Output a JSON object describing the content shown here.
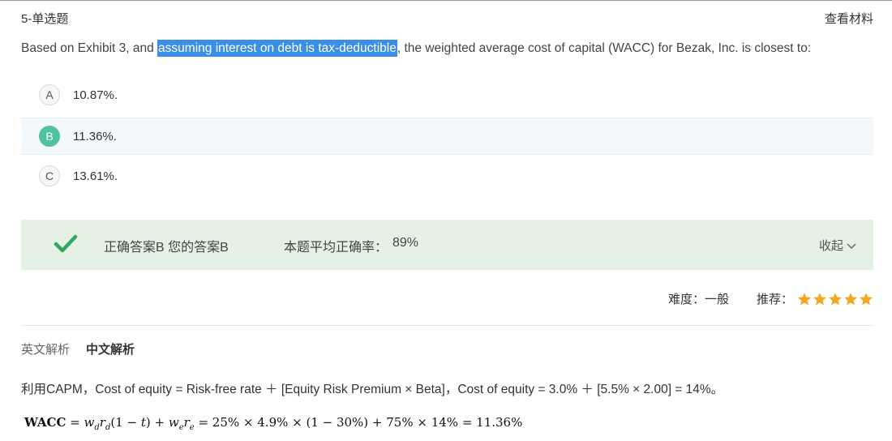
{
  "header": {
    "question_type": "5-单选题",
    "material_link": "查看材料"
  },
  "question": {
    "prefix": "Based on Exhibit 3, and ",
    "highlight": "assuming interest on debt is tax-deductible",
    "suffix": ", the weighted average cost of capital (WACC) for Bezak, Inc. is closest to:"
  },
  "options": [
    {
      "letter": "A",
      "text": "10.87%."
    },
    {
      "letter": "B",
      "text": "11.36%."
    },
    {
      "letter": "C",
      "text": "13.61%."
    }
  ],
  "selected_option": "B",
  "result": {
    "answer_text": "正确答案B 您的答案B",
    "accuracy_label": "本题平均正确率：",
    "accuracy_value": "89%",
    "collapse_label": "收起",
    "status_color": "#2fa75f"
  },
  "meta": {
    "difficulty_label": "难度：",
    "difficulty_value": "一般",
    "recommend_label": "推荐：",
    "stars": 5,
    "star_color": "#f5a623"
  },
  "tabs": {
    "english": "英文解析",
    "chinese": "中文解析",
    "active": "chinese"
  },
  "explanation": {
    "line1": "利用CAPM，Cost of equity = Risk-free rate ＋ [Equity Risk Premium × Beta]，Cost of equity = 3.0% ＋ [5.5% × 2.00] = 14%。",
    "formula": "WACC = w_d r_d (1 − t) + w_e r_e = 25% × 4.9% × (1 − 30%) + 75% × 14% = 11.36%"
  }
}
